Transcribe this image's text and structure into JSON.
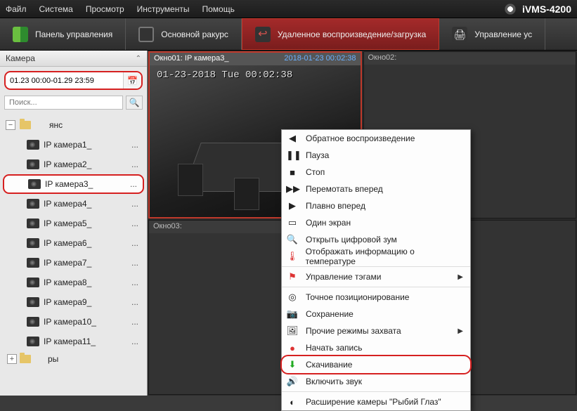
{
  "app": {
    "name": "iVMS-4200"
  },
  "menu": {
    "file": "Файл",
    "system": "Система",
    "view": "Просмотр",
    "tools": "Инструменты",
    "help": "Помощь"
  },
  "tabs": {
    "panel": "Панель управления",
    "mainview": "Основной ракурс",
    "remote": "Удаленное воспроизведение/загрузка",
    "config": "Управление ус"
  },
  "sidebar": {
    "title": "Камера",
    "date_range": "01.23 00:00-01.29 23:59",
    "search_placeholder": "Поиск...",
    "group_label": "янс",
    "items": [
      {
        "label": "IP камера1_"
      },
      {
        "label": "IP камера2_"
      },
      {
        "label": "IP камера3_"
      },
      {
        "label": "IP камера4_"
      },
      {
        "label": "IP камера5_"
      },
      {
        "label": "IP камера6_"
      },
      {
        "label": "IP камера7_"
      },
      {
        "label": "IP камера8_"
      },
      {
        "label": "IP камера9_"
      },
      {
        "label": "IP камера10_"
      },
      {
        "label": "IP камера11_"
      }
    ],
    "foot_label": "ры"
  },
  "panes": {
    "p1": {
      "title": "Окно01: IP камера3_",
      "timestamp": "2018-01-23 00:02:38",
      "osd": "01-23-2018 Tue 00:02:38"
    },
    "p2": {
      "title": "Окно02:"
    },
    "p3": {
      "title": "Окно03:"
    }
  },
  "ctx": {
    "reverse": "Обратное воспроизведение",
    "pause": "Пауза",
    "stop": "Стоп",
    "ff": "Перемотать вперед",
    "sf": "Плавно вперед",
    "single": "Один экран",
    "zoom": "Открыть цифровой зум",
    "temp": "Отображать информацию о температуре",
    "tags": "Управление тэгами",
    "pos": "Точное позиционирование",
    "save": "Сохранение",
    "other": "Прочие режимы захвата",
    "rec": "Начать запись",
    "download": "Скачивание",
    "sound": "Включить звук",
    "fisheye": "Расширение камеры \"Рыбий Глаз\""
  },
  "icons": {
    "cal": "📅",
    "search": "🔍",
    "dots": "...",
    "plus": "+",
    "minus": "−"
  }
}
